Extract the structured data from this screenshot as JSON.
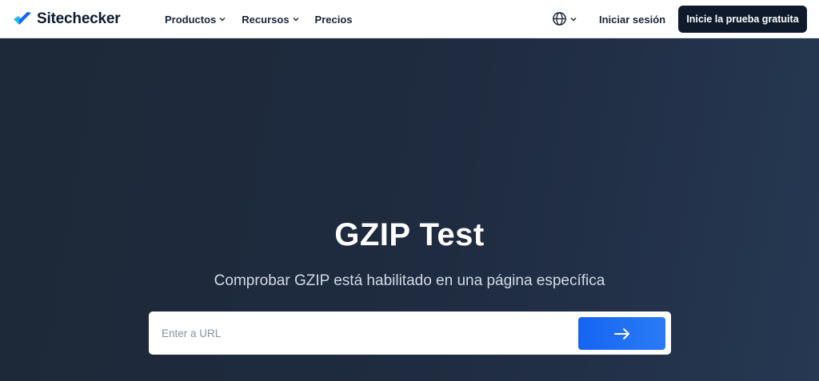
{
  "header": {
    "brand": "Sitechecker",
    "nav": [
      {
        "label": "Productos",
        "has_dropdown": true,
        "icon": "chevron-down-icon"
      },
      {
        "label": "Recursos",
        "has_dropdown": true,
        "icon": "chevron-down-icon"
      },
      {
        "label": "Precios",
        "has_dropdown": false
      }
    ],
    "language_icon": "globe-icon",
    "login_label": "Iniciar sesión",
    "cta_label": "Inicie la prueba gratuita"
  },
  "hero": {
    "title": "GZIP Test",
    "subtitle": "Comprobar GZIP está habilitado en una página específica",
    "search": {
      "placeholder": "Enter a URL",
      "value": "",
      "submit_icon": "arrow-right-icon"
    }
  },
  "colors": {
    "brand_blue": "#1664f2",
    "dark_navy": "#0f1b2c",
    "hero_bg": "#1f2b40"
  }
}
